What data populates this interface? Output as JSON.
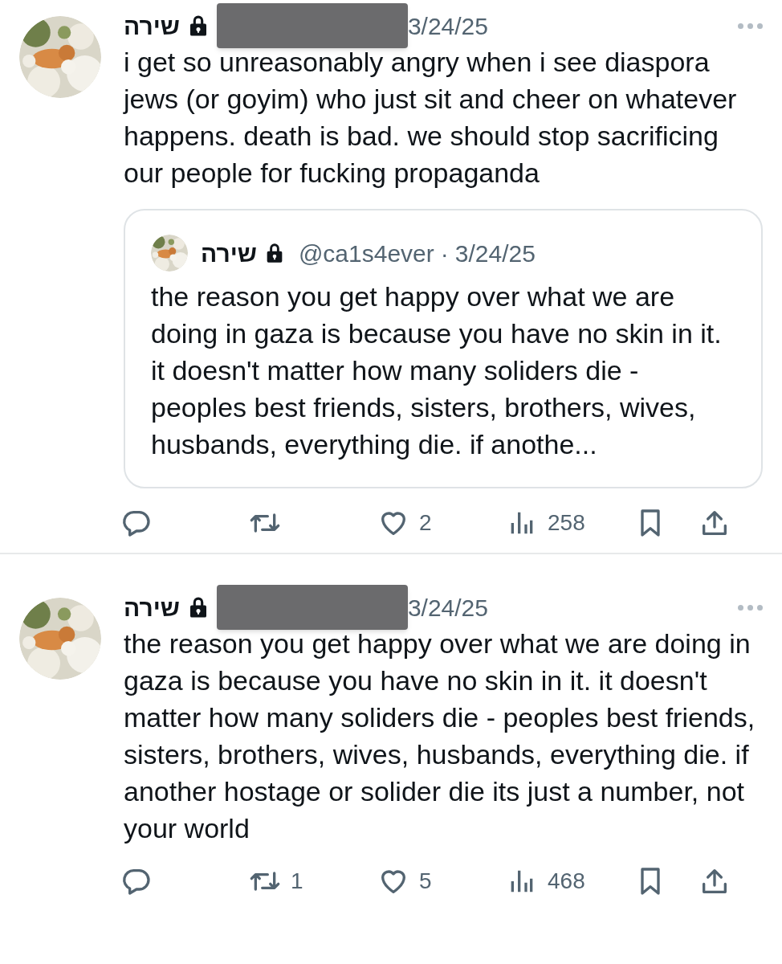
{
  "tweets": [
    {
      "author": "שירה",
      "locked": true,
      "handle_redacted": true,
      "date": "3/24/25",
      "text": "i get so unreasonably angry when i see diaspora jews (or goyim) who just sit and cheer on whatever happens. death is bad. we should stop sacrificing our people for fucking propaganda",
      "quote": {
        "author": "שירה",
        "locked": true,
        "handle": "@ca1s4ever",
        "separator": "·",
        "date": "3/24/25",
        "text": "the reason you get happy over what we are doing in gaza is because you have no skin in it. it doesn't matter how many soliders die - peoples best friends, sisters, brothers, wives, husbands, everything die. if anothe..."
      },
      "actions": [
        {
          "kind": "reply"
        },
        {
          "kind": "retweet"
        },
        {
          "kind": "like",
          "count": "2"
        },
        {
          "kind": "views",
          "count": "258"
        },
        {
          "kind": "bookmark"
        },
        {
          "kind": "share"
        }
      ]
    },
    {
      "author": "שירה",
      "locked": true,
      "handle_redacted": true,
      "date": "3/24/25",
      "text": "the reason you get happy over what we are doing in gaza is because you have no skin in it. it doesn't matter how many soliders die - peoples best friends, sisters, brothers, wives, husbands, everything die. if another hostage or solider die its just a number, not your world",
      "actions": [
        {
          "kind": "reply"
        },
        {
          "kind": "retweet",
          "count": "1"
        },
        {
          "kind": "like",
          "count": "5"
        },
        {
          "kind": "views",
          "count": "468"
        },
        {
          "kind": "bookmark"
        },
        {
          "kind": "share"
        }
      ]
    }
  ]
}
